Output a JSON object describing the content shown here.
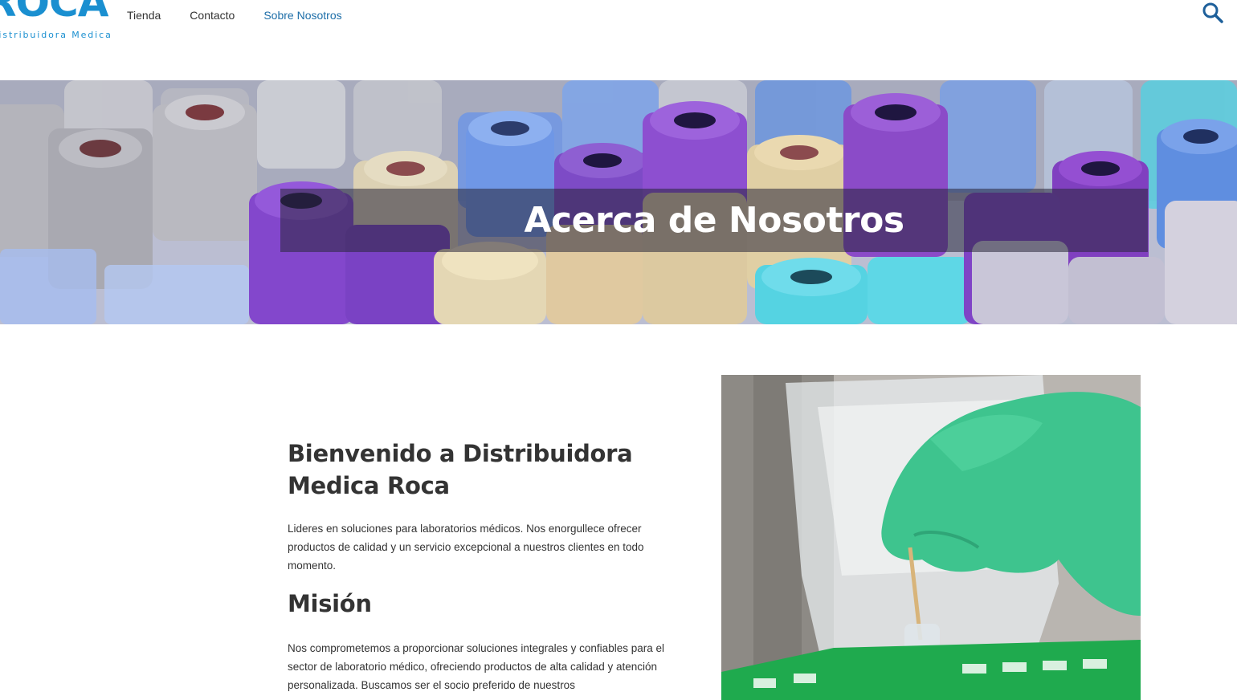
{
  "header": {
    "logo_word": "ROCA",
    "logo_sub": "Distribuidora Medica",
    "nav": [
      {
        "label": "Tienda"
      },
      {
        "label": "Contacto"
      },
      {
        "label": "Sobre Nosotros",
        "active": true
      }
    ],
    "search_icon": "search-icon",
    "accent_color": "#1a8fd0"
  },
  "hero": {
    "title": "Acerca de Nosotros"
  },
  "main": {
    "welcome_title": "Bienvenido a Distribuidora Medica Roca",
    "welcome_text": "Lideres en soluciones para laboratorios médicos. Nos enorgullece ofrecer productos de calidad y un servicio excepcional a nuestros clientes en todo momento.",
    "mision_title": "Misión",
    "mision_text": "Nos comprometemos a proporcionar soluciones integrales y confiables para el sector de laboratorio médico, ofreciendo productos de alta calidad y atención personalizada. Buscamos ser el socio preferido de nuestros"
  }
}
